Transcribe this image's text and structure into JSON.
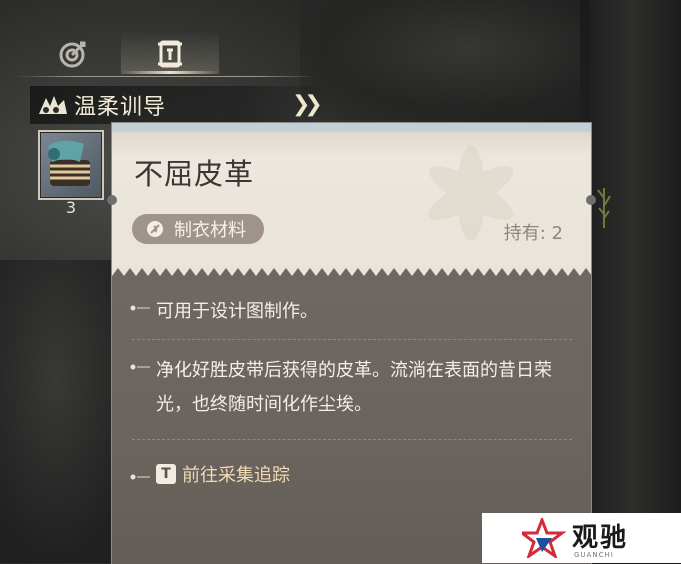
{
  "tabs": [
    {
      "icon": "target-icon",
      "active": false
    },
    {
      "icon": "scroll-icon",
      "active": true
    }
  ],
  "category": {
    "label": "温柔训导",
    "icon": "paw-icon",
    "arrow_icon": "double-chevron-right-icon"
  },
  "slot": {
    "count": "3",
    "icon": "leather-roll-icon"
  },
  "item": {
    "name": "不屈皮革",
    "type_label": "制衣材料",
    "owned_text": "持有: 2",
    "descriptions": [
      "可用于设计图制作。",
      "净化好胜皮带后获得的皮革。流淌在表面的昔日荣光，也终随时间化作尘埃。"
    ],
    "track_key": "T",
    "track_label": "前往采集追踪"
  },
  "watermark": {
    "text": "观驰",
    "sub": "GUANCHI"
  },
  "colors": {
    "panel_light": "#ece7de",
    "panel_dark": "#6b645e",
    "pill_bg": "#9f948d",
    "track_text": "#f0d9b3"
  }
}
